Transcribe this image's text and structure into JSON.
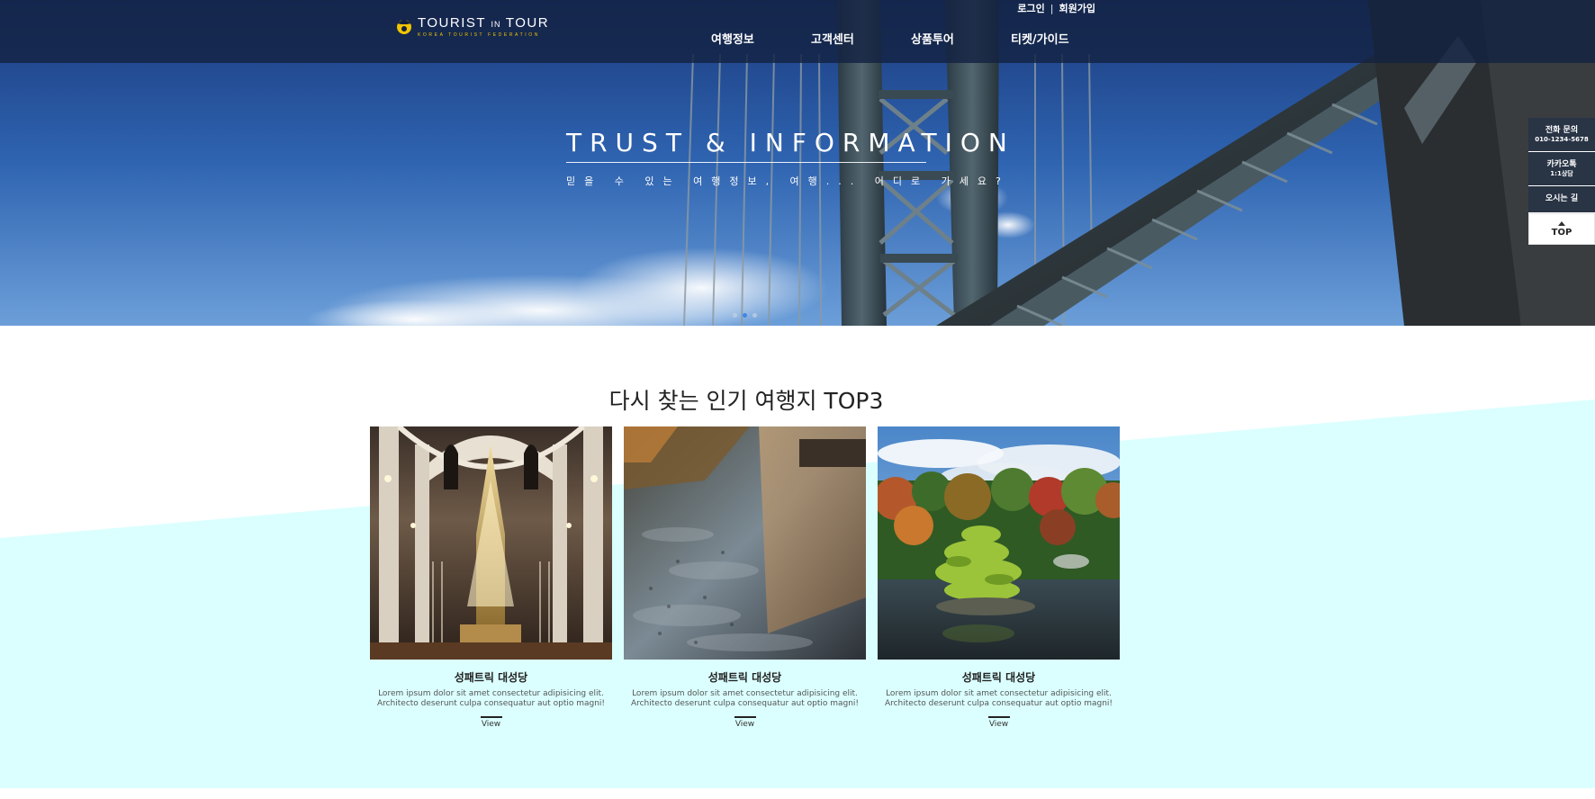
{
  "header": {
    "logo": {
      "title_main": "TOURIST",
      "title_small": "IN",
      "title_end": "TOUR",
      "subtitle": "KOREA TOURIST FEDERATION"
    },
    "util_links": {
      "login": "로그인",
      "separator": "|",
      "signup": "회원가입"
    },
    "nav": [
      {
        "label": "여행정보"
      },
      {
        "label": "고객센터"
      },
      {
        "label": "상품투어"
      },
      {
        "label": "티켓/가이드"
      }
    ]
  },
  "hero": {
    "title": "TRUST & INFORMATION",
    "subtitle": "믿을 수 있는 여행정보, 여행... 어디로 가세요?",
    "slides": {
      "count": 3,
      "active_index": 1
    }
  },
  "quick_menu": {
    "items": [
      {
        "main": "전화 문의",
        "sub": "010-1234-5678"
      },
      {
        "main": "카카오톡",
        "sub": "1:1상담"
      },
      {
        "main": "오시는 길",
        "sub": ""
      }
    ],
    "top_label": "TOP"
  },
  "section": {
    "title": "다시 찾는 인기 여행지 TOP3",
    "cards": [
      {
        "image": "cathedral-interior-photo",
        "title": "성패트릭 대성당",
        "desc_line1": "Lorem ipsum dolor sit amet consectetur adipisicing elit.",
        "desc_line2": "Architecto deserunt culpa consequatur aut optio magni!",
        "link": "View"
      },
      {
        "image": "reflecting-pool-photo",
        "title": "성패트릭 대성당",
        "desc_line1": "Lorem ipsum dolor sit amet consectetur adipisicing elit.",
        "desc_line2": "Architecto deserunt culpa consequatur aut optio magni!",
        "link": "View"
      },
      {
        "image": "japanese-garden-photo",
        "title": "성패트릭 대성당",
        "desc_line1": "Lorem ipsum dolor sit amet consectetur adipisicing elit.",
        "desc_line2": "Architecto deserunt culpa consequatur aut optio magni!",
        "link": "View"
      }
    ]
  },
  "colors": {
    "header_bg": "#142242",
    "accent_yellow": "#f2c500",
    "section_band": "#dbffff",
    "active_dot": "#3f86e8"
  }
}
